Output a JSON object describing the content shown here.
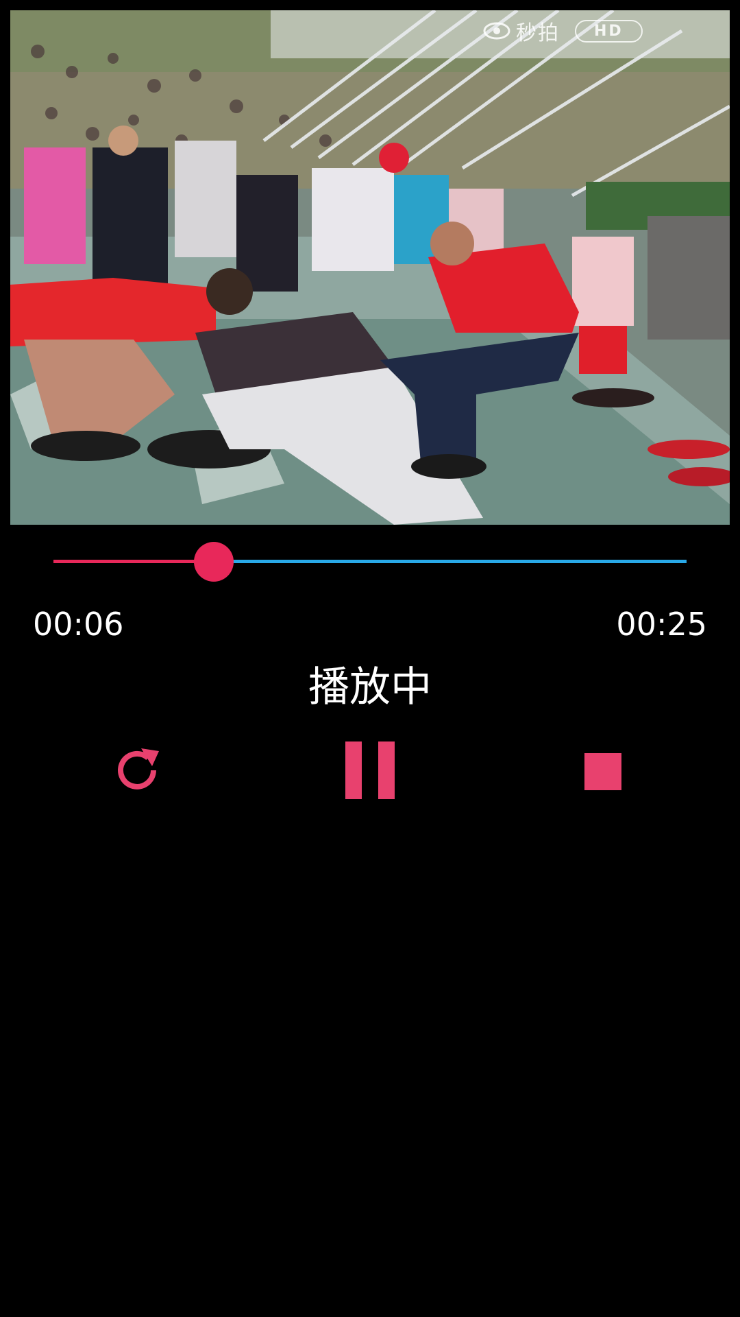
{
  "video": {
    "watermark_text": "秒拍",
    "quality_badge": "HD"
  },
  "player": {
    "current_time": "00:06",
    "total_time": "00:25",
    "progress_fraction": 0.253,
    "status_text": "播放中"
  },
  "controls": {
    "replay_icon": "replay-icon",
    "pause_icon": "pause-icon",
    "stop_icon": "stop-icon"
  },
  "colors": {
    "accent": "#e8285a",
    "icon": "#e8416e",
    "track_remaining": "#29a9e8",
    "background": "#000000"
  }
}
